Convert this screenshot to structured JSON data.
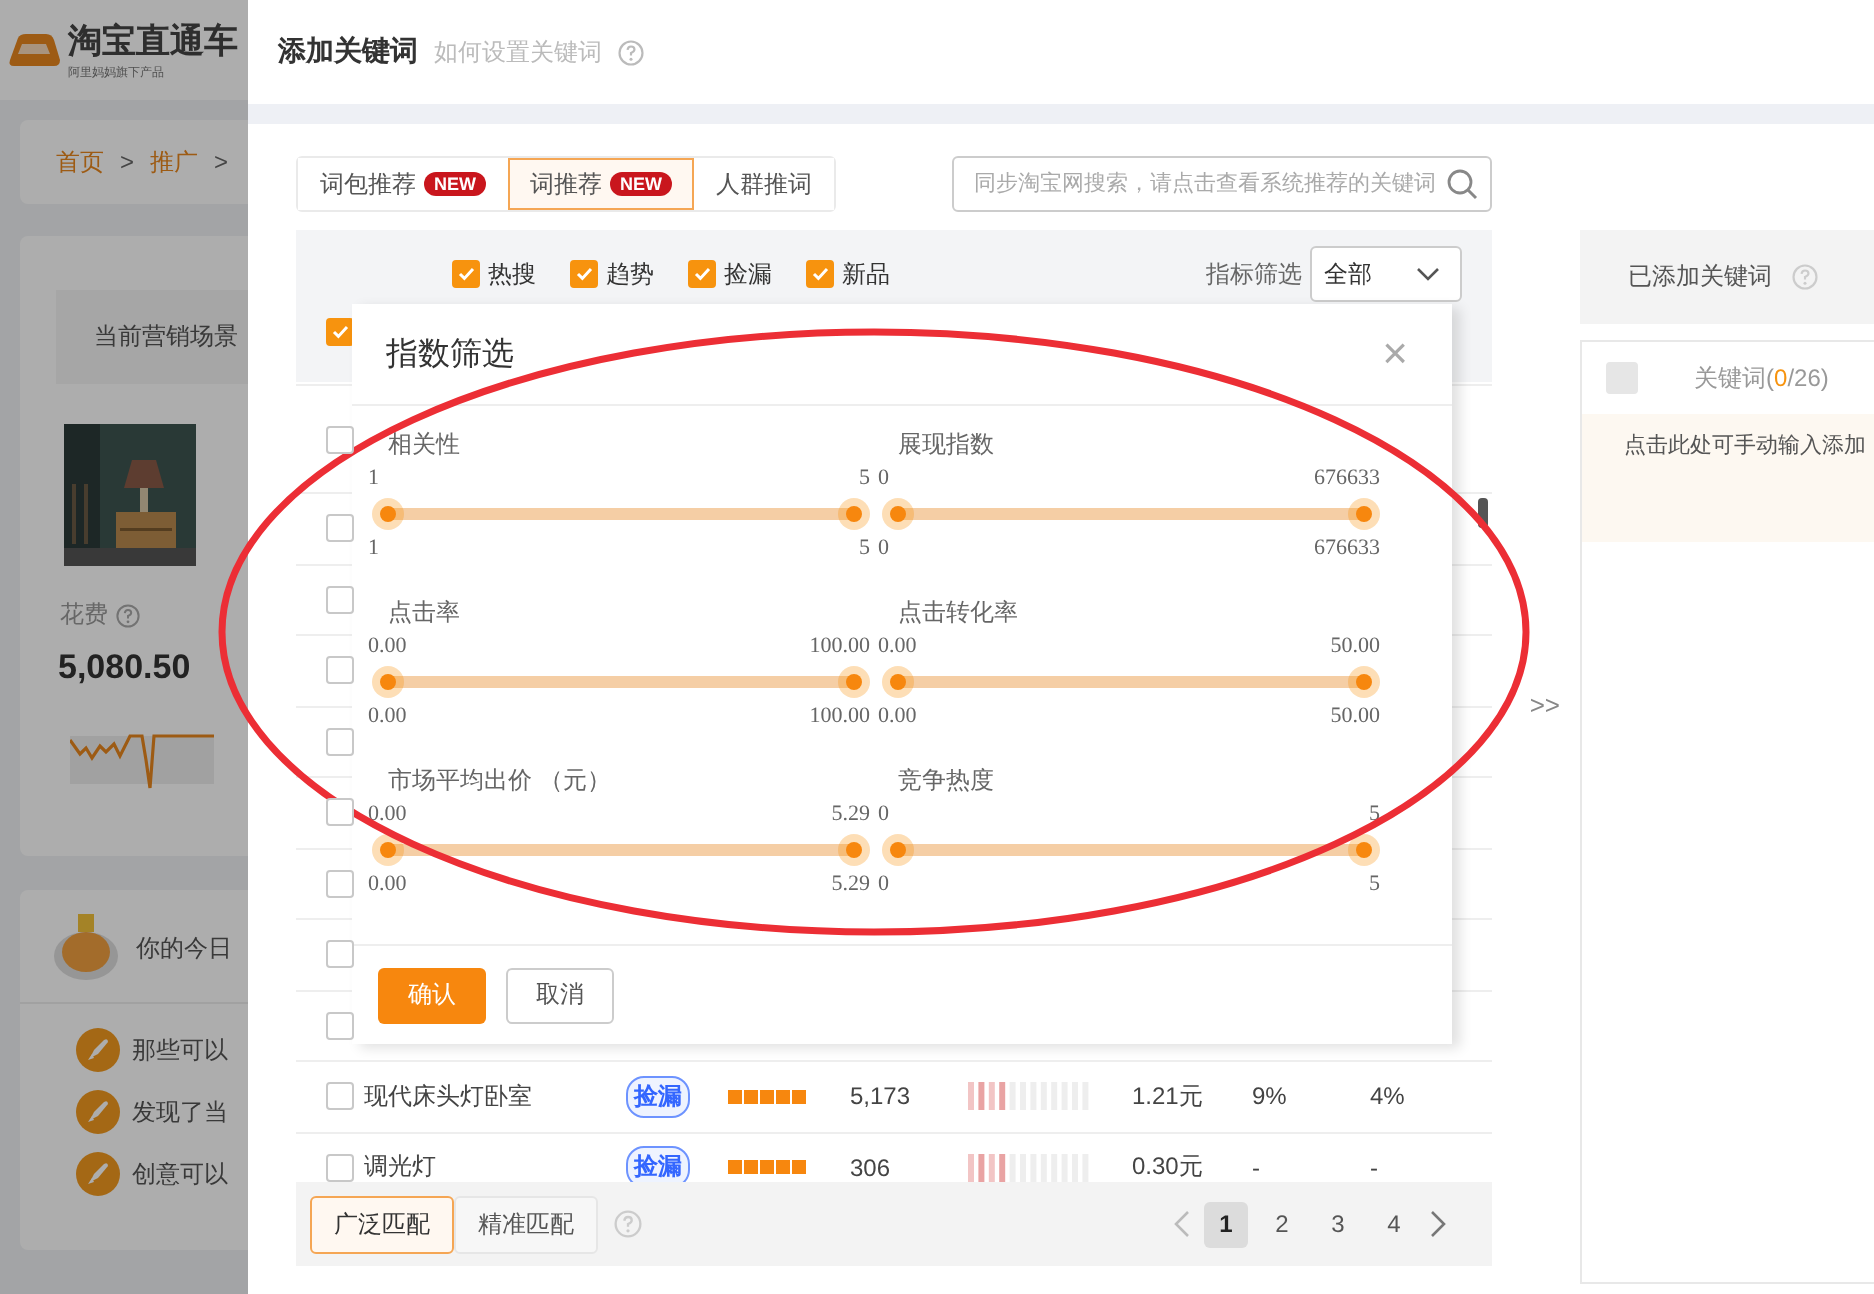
{
  "sidebar": {
    "logo": {
      "title": "淘宝直通车",
      "subtitle": "阿里妈妈旗下产品"
    },
    "breadcrumb": [
      {
        "kind": "link",
        "text": "首页"
      },
      {
        "kind": "sep",
        "text": ">"
      },
      {
        "kind": "link",
        "text": "推广"
      },
      {
        "kind": "sep",
        "text": ">"
      }
    ],
    "scene_label": "当前营销场景",
    "spend": {
      "label": "花费",
      "value": "5,080.50"
    },
    "daily_title": "你的今日",
    "tips": [
      "那些可以",
      "发现了当",
      "创意可以"
    ]
  },
  "drawer": {
    "title": "添加关键词",
    "help_link": "如何设置关键词",
    "tabs": [
      {
        "label": "词包推荐",
        "badge": "NEW",
        "selected": false
      },
      {
        "label": "词推荐",
        "badge": "NEW",
        "selected": true
      },
      {
        "label": "人群推词",
        "selected": false
      }
    ],
    "search": {
      "placeholder": "同步淘宝网搜索，请点击查看系统推荐的关键词"
    },
    "filters": [
      {
        "label": "热搜",
        "checked": true
      },
      {
        "label": "趋势",
        "checked": true
      },
      {
        "label": "捡漏",
        "checked": true
      },
      {
        "label": "新品",
        "checked": true
      }
    ],
    "extra_filter": {
      "checked": true
    },
    "metric_filter": {
      "label": "指标筛选",
      "value": "全部"
    },
    "table": {
      "header_checked": false,
      "rows": [
        {
          "checked": false
        },
        {
          "checked": false
        },
        {
          "checked": false
        },
        {
          "checked": false
        },
        {
          "checked": false
        },
        {
          "checked": false
        },
        {
          "checked": false
        },
        {
          "checked": false
        },
        {
          "checked": false,
          "keyword": "现代床头灯卧室",
          "tag": "捡漏",
          "stars": 5,
          "impressions": "5,173",
          "price": "1.21元",
          "ctr": "9%",
          "cvr": "4%"
        },
        {
          "checked": false,
          "keyword": "调光灯",
          "tag": "捡漏",
          "stars": 5,
          "impressions": "306",
          "price": "0.30元",
          "ctr": "-",
          "cvr": "-"
        }
      ]
    },
    "match_types": [
      {
        "label": "广泛匹配",
        "selected": true
      },
      {
        "label": "精准匹配",
        "selected": false
      }
    ],
    "pages": [
      {
        "label": "1",
        "selected": true
      },
      {
        "label": "2",
        "selected": false
      },
      {
        "label": "3",
        "selected": false
      },
      {
        "label": "4",
        "selected": false
      }
    ],
    "move_button": ">>",
    "added": {
      "title": "已添加关键词",
      "checkbox_disabled": true,
      "count_before": "关键词(",
      "count": "0",
      "count_after": "/26)",
      "hint": "点击此处可手动输入添加"
    }
  },
  "dialog": {
    "title": "指数筛选",
    "close": "×",
    "sliders": [
      {
        "label": "相关性",
        "top_min": "1",
        "top_max": "5",
        "bottom_min": "1",
        "bottom_max": "5"
      },
      {
        "label": "展现指数",
        "top_min": "0",
        "top_max": "676633",
        "bottom_min": "0",
        "bottom_max": "676633"
      },
      {
        "label": "点击率",
        "top_min": "0.00",
        "top_max": "100.00",
        "bottom_min": "0.00",
        "bottom_max": "100.00"
      },
      {
        "label": "点击转化率",
        "top_min": "0.00",
        "top_max": "50.00",
        "bottom_min": "0.00",
        "bottom_max": "50.00"
      },
      {
        "label": "市场平均出价 （元）",
        "top_min": "0.00",
        "top_max": "5.29",
        "bottom_min": "0.00",
        "bottom_max": "5.29"
      },
      {
        "label": "竞争热度",
        "top_min": "0",
        "top_max": "5",
        "bottom_min": "0",
        "bottom_max": "5"
      }
    ],
    "buttons": [
      {
        "label": "确认",
        "kind": "primary"
      },
      {
        "label": "取消",
        "kind": "default"
      }
    ]
  }
}
